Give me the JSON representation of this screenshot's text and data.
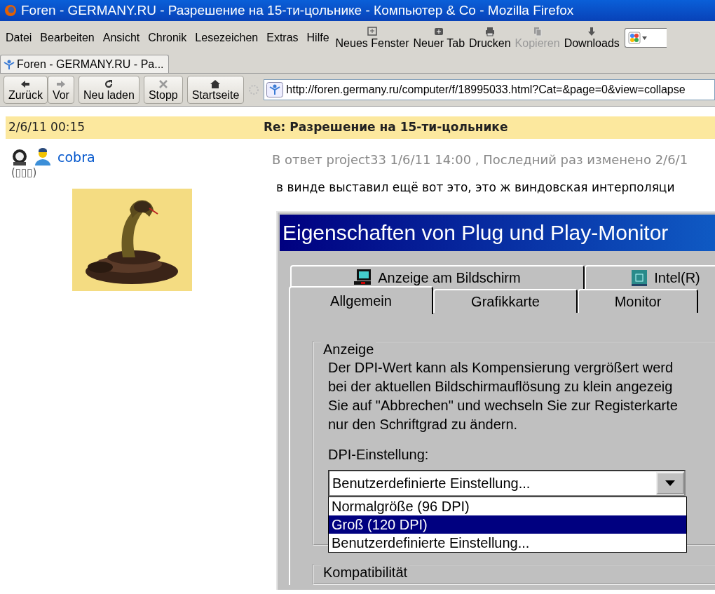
{
  "window": {
    "title": "Foren - GERMANY.RU - Разрешение на 15-ти-цольнике - Компьютер & Co - Mozilla Firefox"
  },
  "menu": [
    "Datei",
    "Bearbeiten",
    "Ansicht",
    "Chronik",
    "Lesezeichen",
    "Extras",
    "Hilfe"
  ],
  "toolbar_buttons": [
    {
      "kind": "window",
      "label": "Neues Fenster",
      "disabled": false
    },
    {
      "kind": "tab",
      "label": "Neuer Tab",
      "disabled": false
    },
    {
      "kind": "print",
      "label": "Drucken",
      "disabled": false
    },
    {
      "kind": "copy",
      "label": "Kopieren",
      "disabled": true
    },
    {
      "kind": "download",
      "label": "Downloads",
      "disabled": false
    }
  ],
  "tabs": [
    {
      "label": "Foren - GERMANY.RU - Pa...",
      "selected": true
    }
  ],
  "nav_buttons": [
    {
      "kind": "back",
      "label": "Zurück",
      "disabled": false
    },
    {
      "kind": "forward",
      "label": "Vor",
      "disabled": true
    },
    {
      "kind": "reload",
      "label": "Neu laden",
      "disabled": false
    },
    {
      "kind": "stop",
      "label": "Stopp",
      "disabled": true
    },
    {
      "kind": "home",
      "label": "Startseite",
      "disabled": false
    }
  ],
  "url": "http://foren.germany.ru/computer/f/18995033.html?Cat=&page=0&view=collapse",
  "post": {
    "date": "2/6/11 00:15",
    "subject": "Re: Разрешение на 15-ти-цольнике",
    "author": "cobra",
    "author_note": "(▯▯▯)",
    "reply_info": "В ответ project33 1/6/11 14:00 , Последний раз изменено 2/6/1",
    "body": "в винде выставил ещё вот это, это ж виндовская интерполяци"
  },
  "dialog": {
    "title": "Eigenschaften von Plug und Play-Monitor",
    "tabs_row1": [
      {
        "kind": "display",
        "label": "Anzeige am Bildschirm",
        "selected": false
      },
      {
        "kind": "chip",
        "label": "Intel(R)",
        "selected": false
      }
    ],
    "tabs_row2": [
      {
        "label": "Allgemein",
        "selected": true
      },
      {
        "label": "Grafikkarte",
        "selected": false
      },
      {
        "label": "Monitor",
        "selected": false
      }
    ],
    "group": "Anzeige",
    "text_lines": [
      "Der DPI-Wert kann als Kompensierung vergrößert werd",
      "bei der aktuellen Bildschirmauflösung zu klein angezeig",
      "Sie auf \"Abbrechen\" und wechseln Sie zur Registerkarte",
      "nur den Schriftgrad zu ändern."
    ],
    "dpi_label": "DPI-Einstellung:",
    "dpi_value": "Benutzerdefinierte Einstellung...",
    "options": [
      {
        "label": "Normalgröße (96 DPI)",
        "selected": false
      },
      {
        "label": "Groß (120 DPI)",
        "selected": true
      },
      {
        "label": "Benutzerdefinierte Einstellung...",
        "selected": false
      }
    ],
    "group2": "Kompatibilität"
  }
}
